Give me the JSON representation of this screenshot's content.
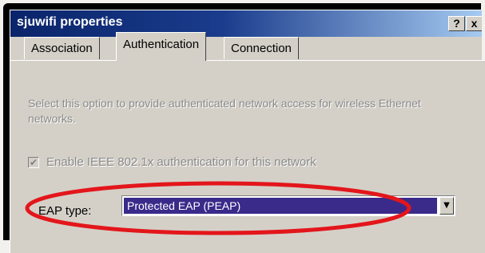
{
  "window": {
    "title": "sjuwifi properties",
    "help_label": "?",
    "close_label": "x"
  },
  "tabs": [
    {
      "label": "Association",
      "active": false
    },
    {
      "label": "Authentication",
      "active": true
    },
    {
      "label": "Connection",
      "active": false
    }
  ],
  "authentication": {
    "description": "Select this option to provide authenticated network access for wireless Ethernet networks.",
    "enable_checkbox": {
      "label": "Enable IEEE 802.1x authentication for this network",
      "checked": true,
      "enabled": false
    },
    "eap_type": {
      "label": "EAP type:",
      "selected": "Protected EAP (PEAP)"
    }
  },
  "annotation": {
    "shape": "ellipse",
    "color": "#e3161b"
  },
  "colors": {
    "title_bar_start": "#0a246a",
    "title_bar_end": "#a6caf0",
    "dialog_face": "#d4d0c8",
    "selection": "#3a2a8a"
  }
}
